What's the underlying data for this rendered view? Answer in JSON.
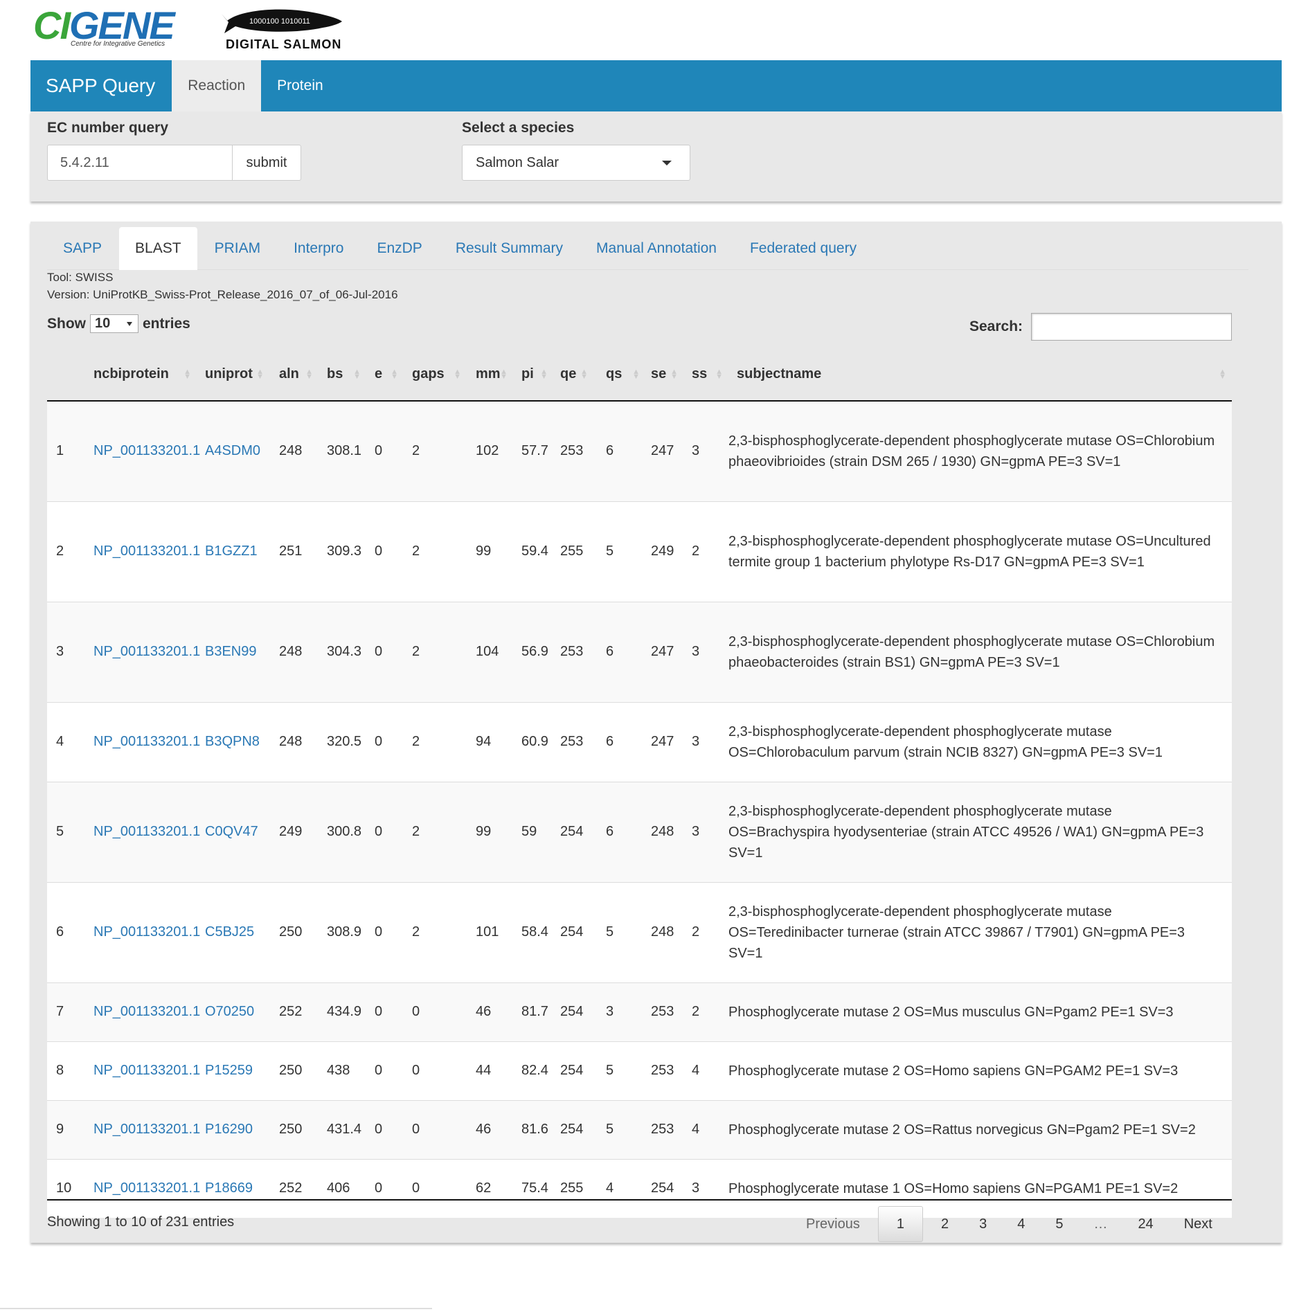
{
  "logos": {
    "cigene": {
      "name": "CIGENE",
      "tagline": "Centre for Integrative Genetics",
      "brand_colors": {
        "blue": "#1f6fb4",
        "green": "#3aa53a"
      }
    },
    "salmon": {
      "binary": "1000100 1010011",
      "caption": "DIGITAL SALMON"
    }
  },
  "topnav": {
    "brand": "SAPP Query",
    "items": [
      {
        "label": "Reaction",
        "active": true
      },
      {
        "label": "Protein",
        "active": false
      }
    ],
    "color": "#1f86b9"
  },
  "query": {
    "ec_label": "EC number query",
    "ec_value": "5.4.2.11",
    "submit_label": "submit",
    "species_label": "Select a species",
    "species_value": "Salmon Salar"
  },
  "tabs": [
    {
      "label": "SAPP",
      "active": false
    },
    {
      "label": "BLAST",
      "active": true
    },
    {
      "label": "PRIAM",
      "active": false
    },
    {
      "label": "Interpro",
      "active": false
    },
    {
      "label": "EnzDP",
      "active": false
    },
    {
      "label": "Result Summary",
      "active": false
    },
    {
      "label": "Manual Annotation",
      "active": false
    },
    {
      "label": "Federated query",
      "active": false
    }
  ],
  "tool": {
    "tool_line": "Tool: SWISS",
    "version_line": "Version: UniProtKB_Swiss-Prot_Release_2016_07_of_06-Jul-2016"
  },
  "controls": {
    "show_label": "Show",
    "entries_value": "10",
    "entries_label": "entries",
    "search_label": "Search:",
    "search_value": ""
  },
  "table": {
    "columns": [
      "",
      "ncbiprotein",
      "uniprot",
      "aln",
      "bs",
      "e",
      "gaps",
      "mm",
      "pi",
      "qe",
      "qs",
      "se",
      "ss",
      "subjectname"
    ],
    "rows": [
      {
        "n": "1",
        "ncbi": "NP_001133201.1",
        "uniprot": "A4SDM0",
        "aln": "248",
        "bs": "308.1",
        "e": "0",
        "gaps": "2",
        "mm": "102",
        "pi": "57.7",
        "qe": "253",
        "qs": "6",
        "se": "247",
        "ss": "3",
        "name": "2,3-bisphosphoglycerate-dependent phosphoglycerate mutase OS=Chlorobium phaeovibrioides (strain DSM 265 / 1930) GN=gpmA PE=3 SV=1"
      },
      {
        "n": "2",
        "ncbi": "NP_001133201.1",
        "uniprot": "B1GZZ1",
        "aln": "251",
        "bs": "309.3",
        "e": "0",
        "gaps": "2",
        "mm": "99",
        "pi": "59.4",
        "qe": "255",
        "qs": "5",
        "se": "249",
        "ss": "2",
        "name": "2,3-bisphosphoglycerate-dependent phosphoglycerate mutase OS=Uncultured termite group 1 bacterium phylotype Rs-D17 GN=gpmA PE=3 SV=1"
      },
      {
        "n": "3",
        "ncbi": "NP_001133201.1",
        "uniprot": "B3EN99",
        "aln": "248",
        "bs": "304.3",
        "e": "0",
        "gaps": "2",
        "mm": "104",
        "pi": "56.9",
        "qe": "253",
        "qs": "6",
        "se": "247",
        "ss": "3",
        "name": "2,3-bisphosphoglycerate-dependent phosphoglycerate mutase OS=Chlorobium phaeobacteroides (strain BS1) GN=gpmA PE=3 SV=1"
      },
      {
        "n": "4",
        "ncbi": "NP_001133201.1",
        "uniprot": "B3QPN8",
        "aln": "248",
        "bs": "320.5",
        "e": "0",
        "gaps": "2",
        "mm": "94",
        "pi": "60.9",
        "qe": "253",
        "qs": "6",
        "se": "247",
        "ss": "3",
        "name": "2,3-bisphosphoglycerate-dependent phosphoglycerate mutase OS=Chlorobaculum parvum (strain NCIB 8327) GN=gpmA PE=3 SV=1"
      },
      {
        "n": "5",
        "ncbi": "NP_001133201.1",
        "uniprot": "C0QV47",
        "aln": "249",
        "bs": "300.8",
        "e": "0",
        "gaps": "2",
        "mm": "99",
        "pi": "59",
        "qe": "254",
        "qs": "6",
        "se": "248",
        "ss": "3",
        "name": "2,3-bisphosphoglycerate-dependent phosphoglycerate mutase OS=Brachyspira hyodysenteriae (strain ATCC 49526 / WA1) GN=gpmA PE=3 SV=1"
      },
      {
        "n": "6",
        "ncbi": "NP_001133201.1",
        "uniprot": "C5BJ25",
        "aln": "250",
        "bs": "308.9",
        "e": "0",
        "gaps": "2",
        "mm": "101",
        "pi": "58.4",
        "qe": "254",
        "qs": "5",
        "se": "248",
        "ss": "2",
        "name": "2,3-bisphosphoglycerate-dependent phosphoglycerate mutase OS=Teredinibacter turnerae (strain ATCC 39867 / T7901) GN=gpmA PE=3 SV=1"
      },
      {
        "n": "7",
        "ncbi": "NP_001133201.1",
        "uniprot": "O70250",
        "aln": "252",
        "bs": "434.9",
        "e": "0",
        "gaps": "0",
        "mm": "46",
        "pi": "81.7",
        "qe": "254",
        "qs": "3",
        "se": "253",
        "ss": "2",
        "name": "Phosphoglycerate mutase 2 OS=Mus musculus GN=Pgam2 PE=1 SV=3"
      },
      {
        "n": "8",
        "ncbi": "NP_001133201.1",
        "uniprot": "P15259",
        "aln": "250",
        "bs": "438",
        "e": "0",
        "gaps": "0",
        "mm": "44",
        "pi": "82.4",
        "qe": "254",
        "qs": "5",
        "se": "253",
        "ss": "4",
        "name": "Phosphoglycerate mutase 2 OS=Homo sapiens GN=PGAM2 PE=1 SV=3"
      },
      {
        "n": "9",
        "ncbi": "NP_001133201.1",
        "uniprot": "P16290",
        "aln": "250",
        "bs": "431.4",
        "e": "0",
        "gaps": "0",
        "mm": "46",
        "pi": "81.6",
        "qe": "254",
        "qs": "5",
        "se": "253",
        "ss": "4",
        "name": "Phosphoglycerate mutase 2 OS=Rattus norvegicus GN=Pgam2 PE=1 SV=2"
      },
      {
        "n": "10",
        "ncbi": "NP_001133201.1",
        "uniprot": "P18669",
        "aln": "252",
        "bs": "406",
        "e": "0",
        "gaps": "0",
        "mm": "62",
        "pi": "75.4",
        "qe": "255",
        "qs": "4",
        "se": "254",
        "ss": "3",
        "name": "Phosphoglycerate mutase 1 OS=Homo sapiens GN=PGAM1 PE=1 SV=2"
      }
    ]
  },
  "footer": {
    "info": "Showing 1 to 10 of 231 entries",
    "pagination": {
      "previous": "Previous",
      "pages": [
        "1",
        "2",
        "3",
        "4",
        "5",
        "…",
        "24"
      ],
      "current": "1",
      "next": "Next"
    }
  },
  "colors": {
    "link": "#2a78b5",
    "panel_bg": "#e8e8e8"
  }
}
